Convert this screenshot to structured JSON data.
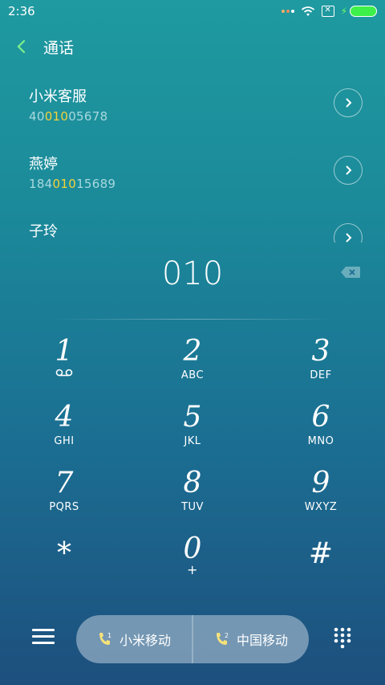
{
  "status": {
    "time": "2:36"
  },
  "header": {
    "title": "通话"
  },
  "contacts": [
    {
      "name": "小米客服",
      "num_pre": "40",
      "num_hl": "010",
      "num_post": "05678"
    },
    {
      "name": "燕婷",
      "num_pre": "184",
      "num_hl": "010",
      "num_post": "15689"
    },
    {
      "name": "子玲",
      "num_pre": "",
      "num_hl": "",
      "num_post": ""
    }
  ],
  "dial_input": "010",
  "keys": [
    {
      "digit": "1",
      "letters": ""
    },
    {
      "digit": "2",
      "letters": "ABC"
    },
    {
      "digit": "3",
      "letters": "DEF"
    },
    {
      "digit": "4",
      "letters": "GHI"
    },
    {
      "digit": "5",
      "letters": "JKL"
    },
    {
      "digit": "6",
      "letters": "MNO"
    },
    {
      "digit": "7",
      "letters": "PQRS"
    },
    {
      "digit": "8",
      "letters": "TUV"
    },
    {
      "digit": "9",
      "letters": "WXYZ"
    },
    {
      "digit": "*",
      "letters": ""
    },
    {
      "digit": "0",
      "letters": "+"
    },
    {
      "digit": "#",
      "letters": ""
    }
  ],
  "sim": [
    {
      "label": "小米移动",
      "slot": "1"
    },
    {
      "label": "中国移动",
      "slot": "2"
    }
  ],
  "colors": {
    "highlight": "#f3d23a",
    "battery": "#3ef04a"
  }
}
